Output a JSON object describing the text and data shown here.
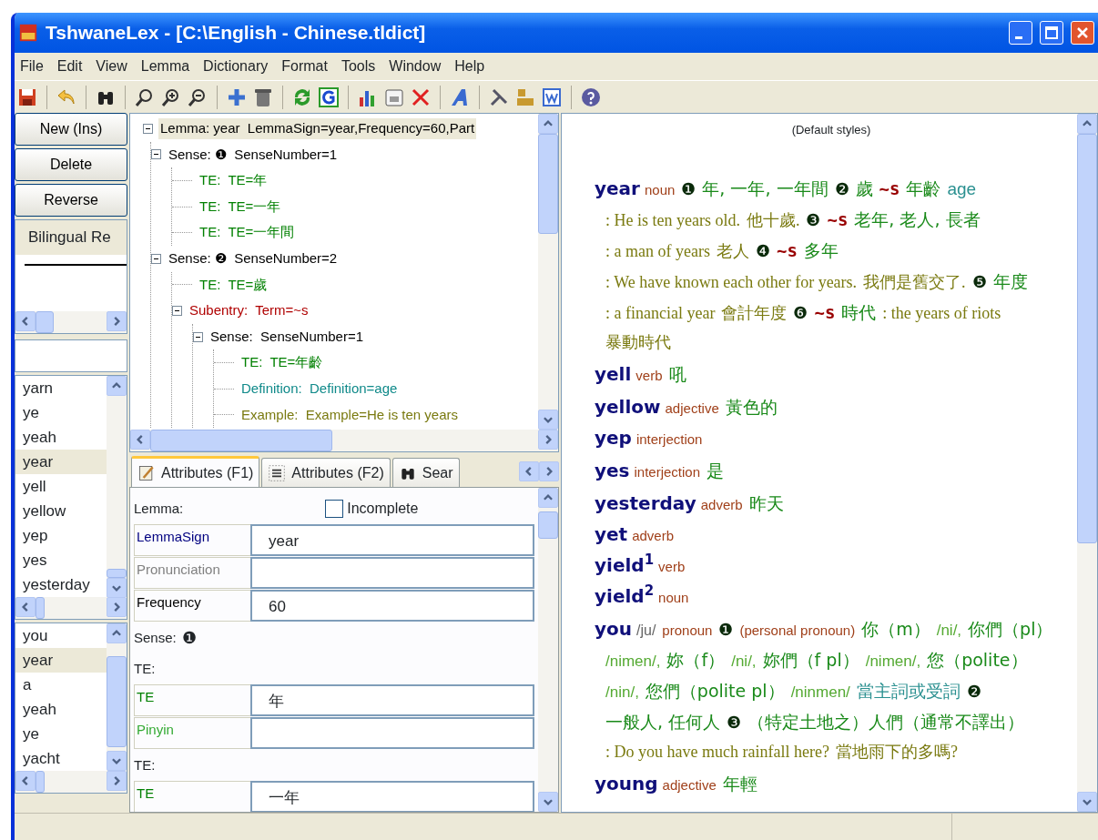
{
  "window": {
    "title": "TshwaneLex - [C:\\English - Chinese.tldict]"
  },
  "menu": [
    "File",
    "Edit",
    "View",
    "Lemma",
    "Dictionary",
    "Format",
    "Tools",
    "Window",
    "Help"
  ],
  "left_panel": {
    "buttons": [
      "New (Ins)",
      "Delete",
      "Reverse"
    ],
    "tab": "Bilingual Re",
    "word_list": [
      {
        "text": "yarn",
        "selected": false
      },
      {
        "text": "ye",
        "selected": false
      },
      {
        "text": "yeah",
        "selected": false
      },
      {
        "text": "year",
        "selected": true
      },
      {
        "text": "yell",
        "selected": false
      },
      {
        "text": "yellow",
        "selected": false
      },
      {
        "text": "yep",
        "selected": false
      },
      {
        "text": "yes",
        "selected": false
      },
      {
        "text": "yesterday",
        "selected": false
      }
    ],
    "history_list": [
      {
        "text": "you",
        "selected": false
      },
      {
        "text": "year",
        "selected": true
      },
      {
        "text": "a",
        "selected": false
      },
      {
        "text": "yeah",
        "selected": false
      },
      {
        "text": "ye",
        "selected": false
      },
      {
        "text": "yacht",
        "selected": false
      }
    ]
  },
  "tree": [
    {
      "kind": "lemma",
      "text": "Lemma: year  LemmaSign=year,Frequency=60,Part",
      "selected": true,
      "expanded": true,
      "children": [
        {
          "kind": "sense",
          "text": "Sense: ❶  SenseNumber=1",
          "selected": false,
          "expanded": true,
          "children": [
            {
              "kind": "te",
              "text": "TE:  TE=年",
              "selected": false
            },
            {
              "kind": "te",
              "text": "TE:  TE=一年",
              "selected": false
            },
            {
              "kind": "te",
              "text": "TE:  TE=一年間",
              "selected": false
            }
          ]
        },
        {
          "kind": "sense",
          "text": "Sense: ❷  SenseNumber=2",
          "selected": false,
          "expanded": true,
          "children": [
            {
              "kind": "te",
              "text": "TE:  TE=歲",
              "selected": false
            },
            {
              "kind": "subentry",
              "text": "Subentry:  Term=~s",
              "selected": false,
              "expanded": true,
              "children": [
                {
                  "kind": "sense",
                  "text": "Sense:  SenseNumber=1",
                  "selected": false,
                  "expanded": true,
                  "children": [
                    {
                      "kind": "te",
                      "text": "TE:  TE=年齡",
                      "selected": false
                    },
                    {
                      "kind": "definition",
                      "text": "Definition:  Definition=age",
                      "selected": false
                    },
                    {
                      "kind": "example",
                      "text": "Example:  Example=He is ten years",
                      "selected": false
                    }
                  ]
                }
              ]
            }
          ]
        }
      ]
    }
  ],
  "tabs": [
    {
      "label": "Attributes (F1)",
      "selected": true
    },
    {
      "label": "Attributes (F2)",
      "selected": false
    },
    {
      "label": "Sear",
      "selected": false
    }
  ],
  "form": [
    {
      "header": "Lemma:",
      "checkbox": {
        "label": "Incomplete",
        "checked": false
      },
      "fields": [
        {
          "label": "LemmaSign",
          "color": "#000080",
          "value": "year"
        },
        {
          "label": "Pronunciation",
          "color": "#808080"
        },
        {
          "label": "Frequency",
          "color": "#000000",
          "value": "60"
        }
      ]
    },
    {
      "header": "Sense:",
      "number": "❶"
    },
    {
      "header": "TE:",
      "fields": [
        {
          "label": "TE",
          "color": "#008000",
          "value": "年"
        },
        {
          "label": "Pinyin",
          "color": "#33aa33"
        }
      ]
    },
    {
      "header": "TE:",
      "fields": [
        {
          "label": "TE",
          "color": "#008000",
          "value": "一年"
        }
      ]
    }
  ],
  "preview": {
    "header": "(Default styles)",
    "entries": [
      [
        {
          "kind": "hw",
          "text": "year"
        },
        {
          "kind": "pos",
          "text": "noun"
        },
        {
          "kind": "num",
          "text": "❶"
        },
        {
          "kind": "te",
          "text": "年, 一年, 一年間"
        },
        {
          "kind": "num",
          "text": "❷"
        },
        {
          "kind": "te",
          "text": "歲"
        },
        {
          "kind": "term",
          "text": "~s"
        },
        {
          "kind": "te",
          "text": "年齡"
        },
        {
          "kind": "def",
          "text": "age"
        },
        {
          "kind": "ex",
          "text": ": He is ten years old."
        },
        {
          "kind": "ex",
          "text": "他十歲."
        },
        {
          "kind": "num",
          "text": "❸"
        },
        {
          "kind": "term",
          "text": "~s"
        },
        {
          "kind": "te",
          "text": "老年, 老人, 長者"
        },
        {
          "kind": "ex",
          "text": ": a man of years"
        },
        {
          "kind": "ex",
          "text": "老人"
        },
        {
          "kind": "num",
          "text": "❹"
        },
        {
          "kind": "term",
          "text": "~s"
        },
        {
          "kind": "te",
          "text": "多年"
        },
        {
          "kind": "ex",
          "text": ": We have known each other for years."
        },
        {
          "kind": "ex",
          "text": "我們是舊交了."
        },
        {
          "kind": "num",
          "text": "❺"
        },
        {
          "kind": "te",
          "text": "年度"
        },
        {
          "kind": "ex",
          "text": ": a financial year"
        },
        {
          "kind": "ex",
          "text": "會計年度"
        },
        {
          "kind": "num",
          "text": "❻"
        },
        {
          "kind": "term",
          "text": "~s"
        },
        {
          "kind": "te",
          "text": "時代"
        },
        {
          "kind": "ex",
          "text": ": the years of riots"
        },
        {
          "kind": "ex",
          "text": "暴動時代"
        }
      ],
      [
        {
          "kind": "hw",
          "text": "yell"
        },
        {
          "kind": "pos",
          "text": "verb"
        },
        {
          "kind": "te",
          "text": "吼"
        }
      ],
      [
        {
          "kind": "hw",
          "text": "yellow"
        },
        {
          "kind": "pos",
          "text": "adjective"
        },
        {
          "kind": "te",
          "text": "黃色的"
        }
      ],
      [
        {
          "kind": "hw",
          "text": "yep"
        },
        {
          "kind": "pos",
          "text": "interjection"
        }
      ],
      [
        {
          "kind": "hw",
          "text": "yes"
        },
        {
          "kind": "pos",
          "text": "interjection"
        },
        {
          "kind": "te",
          "text": "是"
        }
      ],
      [
        {
          "kind": "hw",
          "text": "yesterday"
        },
        {
          "kind": "pos",
          "text": "adverb"
        },
        {
          "kind": "te",
          "text": "昨天"
        }
      ],
      [
        {
          "kind": "hw",
          "text": "yet"
        },
        {
          "kind": "pos",
          "text": "adverb"
        }
      ],
      [
        {
          "kind": "hw",
          "text": "yield$^{1}$"
        },
        {
          "kind": "pos",
          "text": "verb"
        }
      ],
      [
        {
          "kind": "hw",
          "text": "yield$^{2}$"
        },
        {
          "kind": "pos",
          "text": "noun"
        }
      ],
      [
        {
          "kind": "hw",
          "text": "you"
        },
        {
          "kind": "pron",
          "text": "/ju/"
        },
        {
          "kind": "pos",
          "text": "pronoun"
        },
        {
          "kind": "num",
          "text": "❶"
        },
        {
          "kind": "pos",
          "text": "(personal pronoun)"
        },
        {
          "kind": "te",
          "text": "你（m）"
        },
        {
          "kind": "pinyin",
          "text": "/ni/,"
        },
        {
          "kind": "te",
          "text": "你們（pl）"
        },
        {
          "kind": "pinyin",
          "text": "/nimen/,"
        },
        {
          "kind": "te",
          "text": "妳（f）"
        },
        {
          "kind": "pinyin",
          "text": "/ni/,"
        },
        {
          "kind": "te",
          "text": "妳們（f pl）"
        },
        {
          "kind": "pinyin",
          "text": "/nimen/,"
        },
        {
          "kind": "te",
          "text": "您（polite）"
        },
        {
          "kind": "pinyin",
          "text": "/nin/,"
        },
        {
          "kind": "te",
          "text": "您們（polite pl）"
        },
        {
          "kind": "pinyin",
          "text": "/ninmen/"
        },
        {
          "kind": "def",
          "text": "當主詞或受詞"
        },
        {
          "kind": "num",
          "text": "❷"
        },
        {
          "kind": "te",
          "text": "一般人, 任何人"
        },
        {
          "kind": "num",
          "text": "❸"
        },
        {
          "kind": "te",
          "text": "（特定土地之）人們（通常不譯出）"
        },
        {
          "kind": "ex",
          "text": ": Do you have much rainfall here?"
        },
        {
          "kind": "ex",
          "text": "當地雨下的多嗎?"
        }
      ],
      [
        {
          "kind": "hw",
          "text": "young"
        },
        {
          "kind": "pos",
          "text": "adjective"
        },
        {
          "kind": "te",
          "text": "年輕"
        }
      ]
    ]
  }
}
